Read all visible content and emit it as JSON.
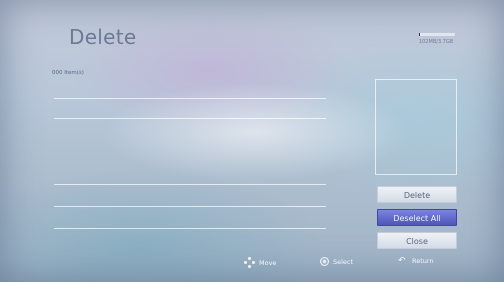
{
  "screen": {
    "title": "Delete",
    "item_count": "000 Item(s)"
  },
  "capacity": {
    "text": "102MB/3.7GB",
    "fill_fraction": 0.03
  },
  "buttons": [
    {
      "label": "Delete",
      "selected": false
    },
    {
      "label": "Deselect All",
      "selected": true
    },
    {
      "label": "Close",
      "selected": false
    }
  ],
  "footer": {
    "move_label": "Move",
    "select_label": "Select",
    "return_label": "Return"
  },
  "icons": {
    "move": "move-arrows-icon",
    "select": "select-circle-icon",
    "return": "return-arrow-icon"
  },
  "colors": {
    "title": "#6e7a93",
    "selected_button": "#4d56b9",
    "normal_button": "#e4e9f0"
  }
}
